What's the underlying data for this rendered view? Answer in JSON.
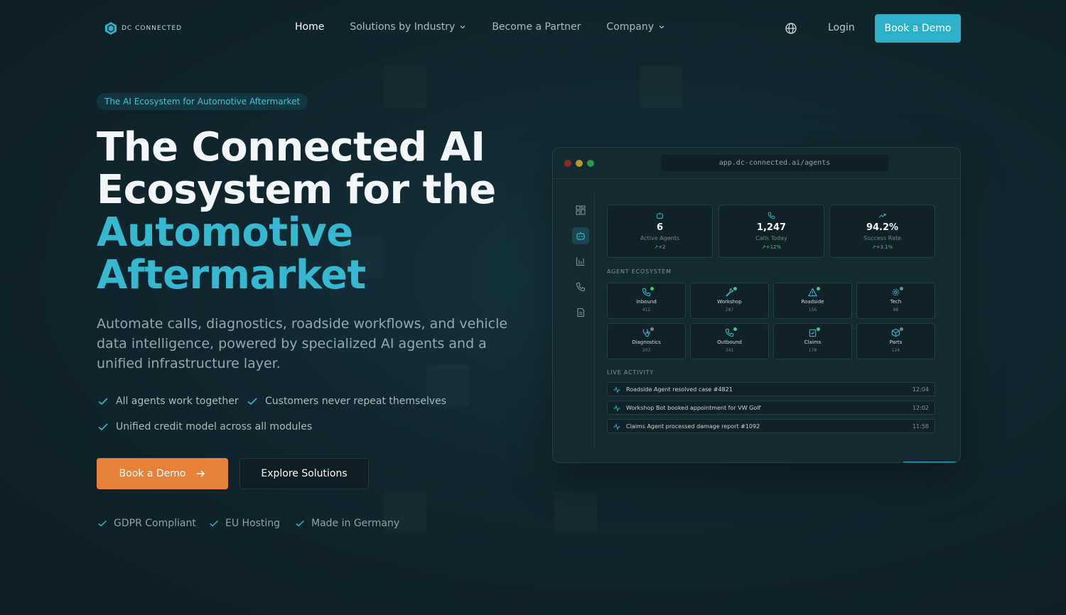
{
  "brand": {
    "name": "DC CONNECTED"
  },
  "nav": {
    "links": [
      {
        "label": "Home",
        "active": true,
        "dropdown": false
      },
      {
        "label": "Solutions by Industry",
        "active": false,
        "dropdown": true
      },
      {
        "label": "Become a Partner",
        "active": false,
        "dropdown": false
      },
      {
        "label": "Company",
        "active": false,
        "dropdown": true
      }
    ],
    "login": "Login",
    "cta": "Book a Demo"
  },
  "hero": {
    "badge": "The AI Ecosystem for Automotive Aftermarket",
    "title_line1": "The Connected AI",
    "title_line2": "Ecosystem for the",
    "title_line3": "Automotive",
    "title_line4": "Aftermarket",
    "subtitle": "Automate calls, diagnostics, roadside workflows, and vehicle data intelligence, powered by specialized AI agents and a unified infrastructure layer.",
    "checks": [
      "All agents work together",
      "Customers never repeat themselves",
      "Unified credit model across all modules"
    ],
    "primary_cta": "Book a Demo",
    "secondary_cta": "Explore Solutions",
    "trust": [
      "GDPR Compliant",
      "EU Hosting",
      "Made in Germany"
    ]
  },
  "app": {
    "url": "app.dc-connected.ai/agents",
    "stats": [
      {
        "icon": "bot-icon",
        "value": "6",
        "label": "Active Agents",
        "change": "+2"
      },
      {
        "icon": "phone-icon",
        "value": "1,247",
        "label": "Calls Today",
        "change": "+12%"
      },
      {
        "icon": "trend-up-icon",
        "value": "94.2%",
        "label": "Success Rate",
        "change": "+3.1%"
      }
    ],
    "ecosystem_title": "AGENT ECOSYSTEM",
    "agents": [
      {
        "name": "Inbound",
        "count": "412",
        "icon": "phone-in-icon",
        "status": "online"
      },
      {
        "name": "Workshop",
        "count": "287",
        "icon": "wrench-icon",
        "status": "online"
      },
      {
        "name": "Roadside",
        "count": "156",
        "icon": "warning-icon",
        "status": "online"
      },
      {
        "name": "Tech",
        "count": "98",
        "icon": "gear-icon",
        "status": "idle"
      },
      {
        "name": "Diagnostics",
        "count": "203",
        "icon": "stethoscope-icon",
        "status": "idle"
      },
      {
        "name": "Outbound",
        "count": "341",
        "icon": "phone-out-icon",
        "status": "online"
      },
      {
        "name": "Claims",
        "count": "178",
        "icon": "clipboard-icon",
        "status": "online"
      },
      {
        "name": "Parts",
        "count": "124",
        "icon": "box-icon",
        "status": "idle"
      }
    ],
    "activity_title": "LIVE ACTIVITY",
    "activity": [
      {
        "text": "Roadside Agent resolved case #4821",
        "time": "12:04"
      },
      {
        "text": "Workshop Bot booked appointment for VW Golf",
        "time": "12:02"
      },
      {
        "text": "Claims Agent processed damage report #1092",
        "time": "11:58"
      }
    ]
  },
  "colors": {
    "accent": "#2fb0c9",
    "cta": "#e8813a",
    "success": "#3ccb82",
    "background": "#10262e"
  }
}
